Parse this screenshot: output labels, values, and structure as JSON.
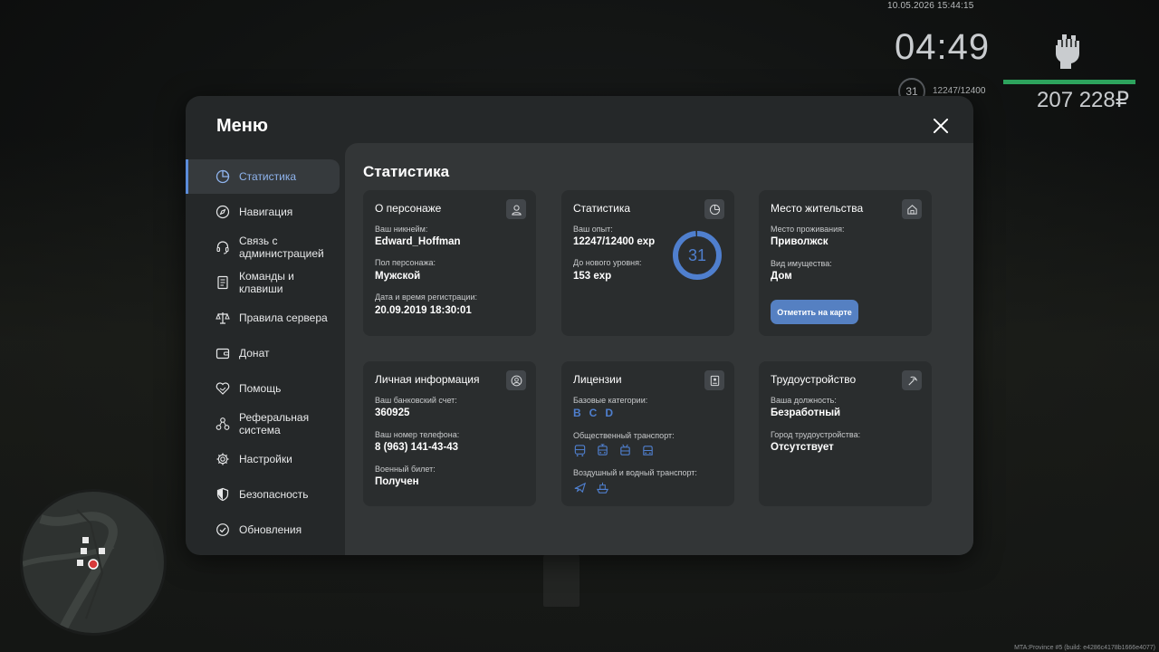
{
  "hud": {
    "datetime": "10.05.2026 15:44:15",
    "clock": "04:49",
    "level": "31",
    "exp": "12247/12400",
    "money": "207 228₽",
    "health_fraction": 1.0,
    "health_color": "#2da35d"
  },
  "build_info": "MTA:Province #5 (build: e4286c4178b1666e4077)",
  "menu": {
    "title": "Меню",
    "accent_color": "#5b8cd9",
    "sidebar": [
      {
        "label": "Статистика",
        "icon": "statistics-icon",
        "active": true
      },
      {
        "label": "Навигация",
        "icon": "compass-icon",
        "active": false
      },
      {
        "label": "Связь с администрацией",
        "icon": "headset-icon",
        "active": false
      },
      {
        "label": "Команды и клавиши",
        "icon": "document-icon",
        "active": false
      },
      {
        "label": "Правила сервера",
        "icon": "scales-icon",
        "active": false
      },
      {
        "label": "Донат",
        "icon": "wallet-icon",
        "active": false
      },
      {
        "label": "Помощь",
        "icon": "handshake-heart-icon",
        "active": false
      },
      {
        "label": "Реферальная система",
        "icon": "network-icon",
        "active": false
      },
      {
        "label": "Настройки",
        "icon": "gear-icon",
        "active": false
      },
      {
        "label": "Безопасность",
        "icon": "shield-icon",
        "active": false
      },
      {
        "label": "Обновления",
        "icon": "check-circle-icon",
        "active": false
      }
    ],
    "section_title": "Статистика",
    "cards": {
      "character": {
        "title": "О персонаже",
        "icon": "user-icon",
        "nick_label": "Ваш никнейм:",
        "nick": "Edward_Hoffman",
        "gender_label": "Пол персонажа:",
        "gender": "Мужской",
        "reg_label": "Дата и время регистрации:",
        "reg": "20.09.2019 18:30:01"
      },
      "stats": {
        "title": "Статистика",
        "icon": "pie-chart-icon",
        "exp_label": "Ваш опыт:",
        "exp": "12247/12400 exp",
        "next_label": "До нового уровня:",
        "next": "153 exp",
        "level": "31",
        "level_progress": 0.988
      },
      "residence": {
        "title": "Место жительства",
        "icon": "house-icon",
        "place_label": "Место проживания:",
        "place": "Приволжск",
        "type_label": "Вид имущества:",
        "type": "Дом",
        "button": "Отметить на карте"
      },
      "personal": {
        "title": "Личная информация",
        "icon": "user-circle-icon",
        "bank_label": "Ваш банковский счет:",
        "bank": "360925",
        "phone_label": "Ваш номер телефона:",
        "phone": "8 (963) 141-43-43",
        "military_label": "Военный билет:",
        "military": "Получен"
      },
      "licenses": {
        "title": "Лицензии",
        "icon": "id-card-icon",
        "base_label": "Базовые категории:",
        "categories": [
          "B",
          "C",
          "D"
        ],
        "public_label": "Общественный транспорт:",
        "public_icons": [
          "bus-icon",
          "tram-icon",
          "trolleybus-icon",
          "minibus-icon"
        ],
        "air_label": "Воздушный и водный транспорт:",
        "air_icons": [
          "plane-icon",
          "ship-icon"
        ]
      },
      "employment": {
        "title": "Трудоустройство",
        "icon": "pickaxe-icon",
        "position_label": "Ваша должность:",
        "position": "Безработный",
        "city_label": "Город трудоустройства:",
        "city": "Отсутствует"
      }
    }
  }
}
